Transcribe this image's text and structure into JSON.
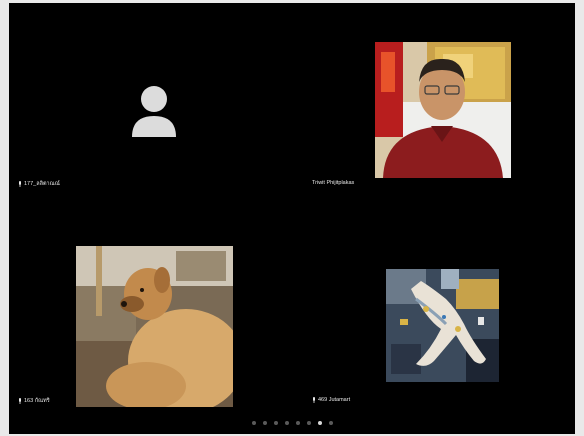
{
  "participants": [
    {
      "name": "177_ลลิตาณณ์",
      "mic_icon": "mic-icon",
      "video": "off",
      "avatar_icon": "person-avatar-icon"
    },
    {
      "name": "Triwit Phijitplakas",
      "video": "on",
      "photo": "man-in-red-shirt"
    },
    {
      "name": "163 กัณทริ",
      "mic_icon": "mic-icon",
      "video": "on",
      "photo": "dog-lying-down"
    },
    {
      "name": "469 Jutamart",
      "mic_icon": "mic-icon",
      "video": "on",
      "photo": "artwork-hands"
    }
  ],
  "pagination": {
    "count": 8,
    "active_index": 6
  },
  "colors": {
    "background": "#000000",
    "label_text": "#e8e8e8",
    "dot_inactive": "#5a5a5a",
    "dot_active": "#d8d8d8"
  }
}
